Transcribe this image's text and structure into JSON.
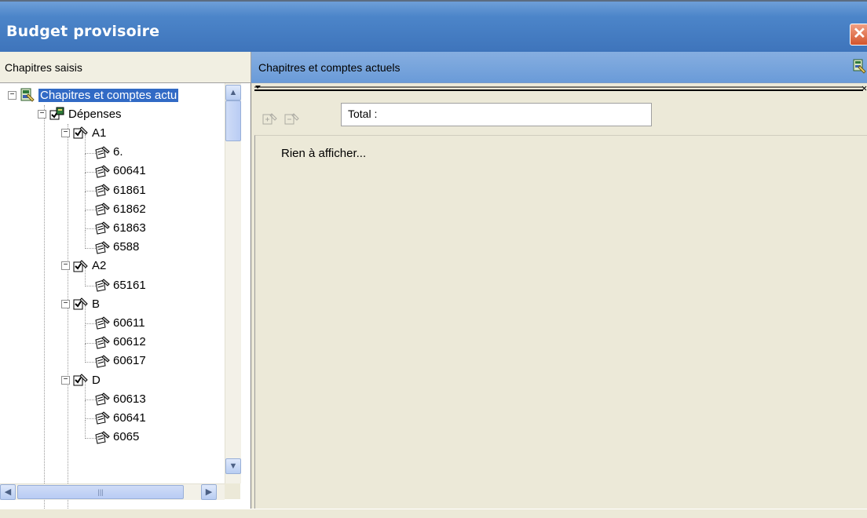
{
  "window": {
    "title": "Budget provisoire",
    "close_glyph": "✕"
  },
  "left_panel": {
    "header": "Chapitres saisis",
    "tree": [
      {
        "label": "Chapitres et comptes actu",
        "level": 0,
        "expander": "−",
        "icon": "root-accounts-icon",
        "selected": true
      },
      {
        "label": "Dépenses",
        "level": 1,
        "expander": "−",
        "icon": "folder-checked-icon"
      },
      {
        "label": "A1",
        "level": 2,
        "expander": "−",
        "icon": "chapter-icon"
      },
      {
        "label": "6.",
        "level": 3,
        "icon": "account-edit-icon"
      },
      {
        "label": "60641",
        "level": 3,
        "icon": "account-edit-icon"
      },
      {
        "label": "61861",
        "level": 3,
        "icon": "account-edit-icon"
      },
      {
        "label": "61862",
        "level": 3,
        "icon": "account-edit-icon"
      },
      {
        "label": "61863",
        "level": 3,
        "icon": "account-edit-icon"
      },
      {
        "label": "6588",
        "level": 3,
        "icon": "account-edit-icon"
      },
      {
        "label": "A2",
        "level": 2,
        "expander": "−",
        "icon": "chapter-icon"
      },
      {
        "label": "65161",
        "level": 3,
        "icon": "account-edit-icon"
      },
      {
        "label": "B",
        "level": 2,
        "expander": "−",
        "icon": "chapter-icon"
      },
      {
        "label": "60611",
        "level": 3,
        "icon": "account-edit-icon"
      },
      {
        "label": "60612",
        "level": 3,
        "icon": "account-edit-icon"
      },
      {
        "label": "60617",
        "level": 3,
        "icon": "account-edit-icon"
      },
      {
        "label": "D",
        "level": 2,
        "expander": "−",
        "icon": "chapter-icon"
      },
      {
        "label": "60613",
        "level": 3,
        "icon": "account-edit-icon"
      },
      {
        "label": "60641",
        "level": 3,
        "icon": "account-edit-icon"
      },
      {
        "label": "6065",
        "level": 3,
        "icon": "account-edit-icon"
      }
    ],
    "scroll_up": "▲",
    "scroll_down": "▼",
    "scroll_left": "◀",
    "scroll_right": "▶",
    "hthumb_grip": "|||"
  },
  "right_panel": {
    "header": "Chapitres et comptes actuels",
    "total_label": "Total :",
    "empty_message": "Rien à afficher..."
  },
  "colors": {
    "title_bar": "#3e74bb",
    "selection": "#316ac5",
    "panel_header": "#6a9bd8",
    "background": "#ece9d8"
  }
}
